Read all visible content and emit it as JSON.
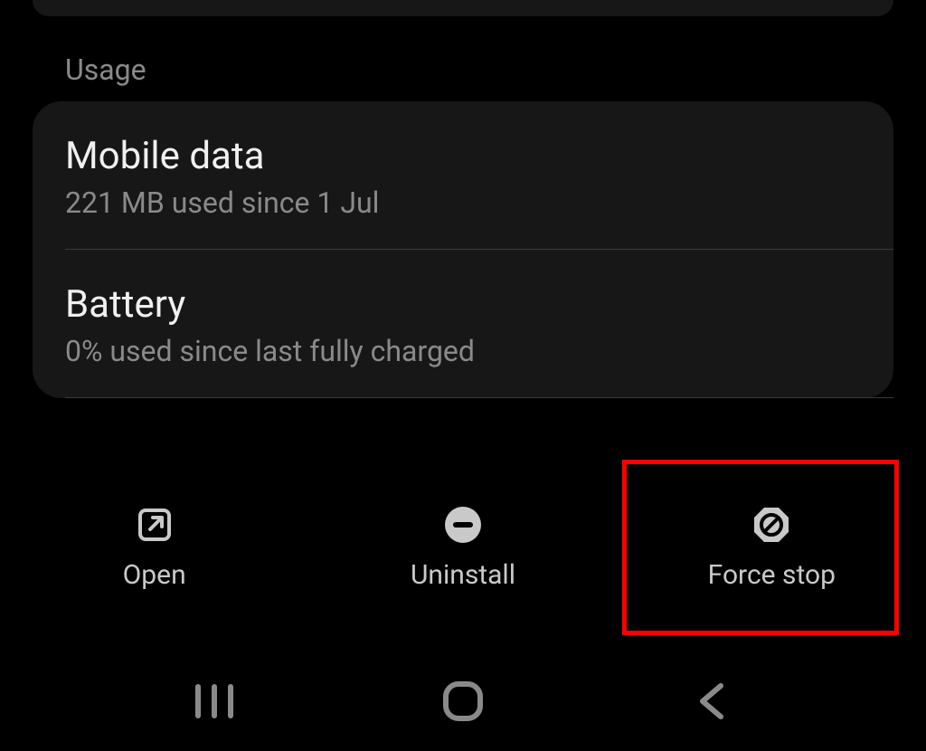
{
  "section": {
    "header": "Usage",
    "items": [
      {
        "title": "Mobile data",
        "subtitle": "221 MB used since 1 Jul"
      },
      {
        "title": "Battery",
        "subtitle": "0% used since last fully charged"
      }
    ]
  },
  "actions": {
    "open": "Open",
    "uninstall": "Uninstall",
    "force_stop": "Force stop"
  }
}
